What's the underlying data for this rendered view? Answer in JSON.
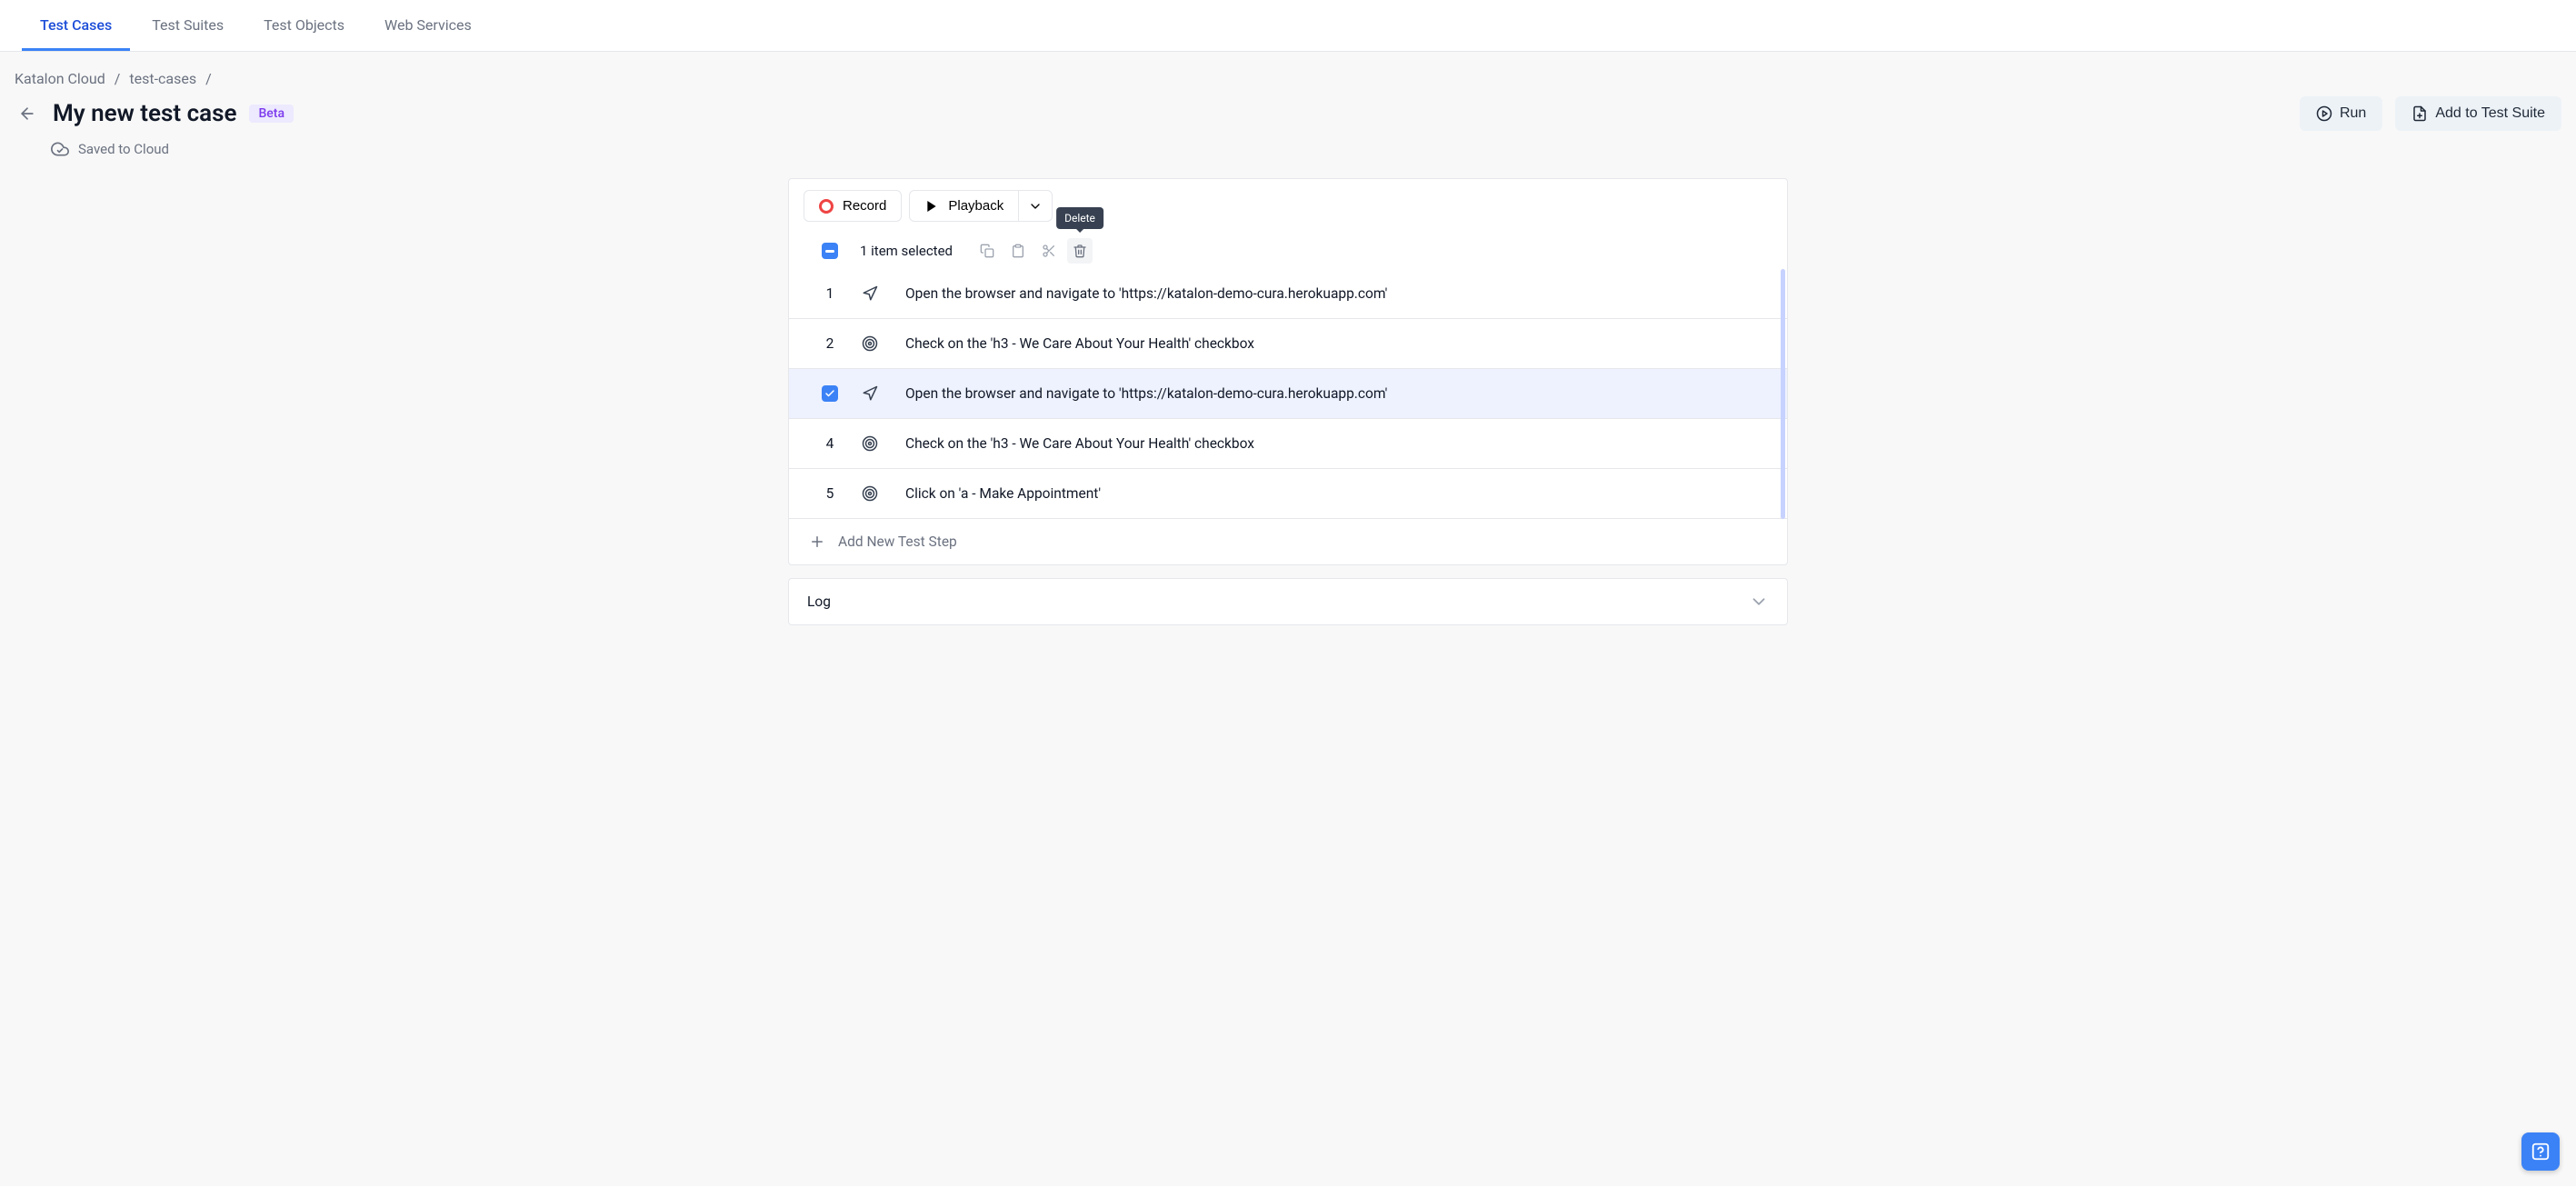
{
  "tabs": [
    {
      "label": "Test Cases",
      "active": true
    },
    {
      "label": "Test Suites",
      "active": false
    },
    {
      "label": "Test Objects",
      "active": false
    },
    {
      "label": "Web Services",
      "active": false
    }
  ],
  "breadcrumb": {
    "root": "Katalon Cloud",
    "section": "test-cases"
  },
  "title": "My new test case",
  "badge": "Beta",
  "header_actions": {
    "run": "Run",
    "add_to_suite": "Add to Test Suite"
  },
  "cloud_status": "Saved to Cloud",
  "editor_toolbar": {
    "record": "Record",
    "playback": "Playback"
  },
  "selection": {
    "count_text": "1 item selected",
    "tooltip_delete": "Delete"
  },
  "steps": [
    {
      "num": "1",
      "icon": "navigate",
      "text": "Open the browser and navigate to 'https://katalon-demo-cura.herokuapp.com'",
      "selected": false
    },
    {
      "num": "2",
      "icon": "target",
      "text": "Check on the 'h3 - We Care About Your Health' checkbox",
      "selected": false
    },
    {
      "num": "",
      "icon": "navigate",
      "text": "Open the browser and navigate to 'https://katalon-demo-cura.herokuapp.com'",
      "selected": true
    },
    {
      "num": "4",
      "icon": "target",
      "text": "Check on the 'h3 - We Care About Your Health' checkbox",
      "selected": false
    },
    {
      "num": "5",
      "icon": "target",
      "text": "Click on 'a - Make Appointment'",
      "selected": false
    }
  ],
  "add_step_label": "Add New Test Step",
  "log_label": "Log"
}
